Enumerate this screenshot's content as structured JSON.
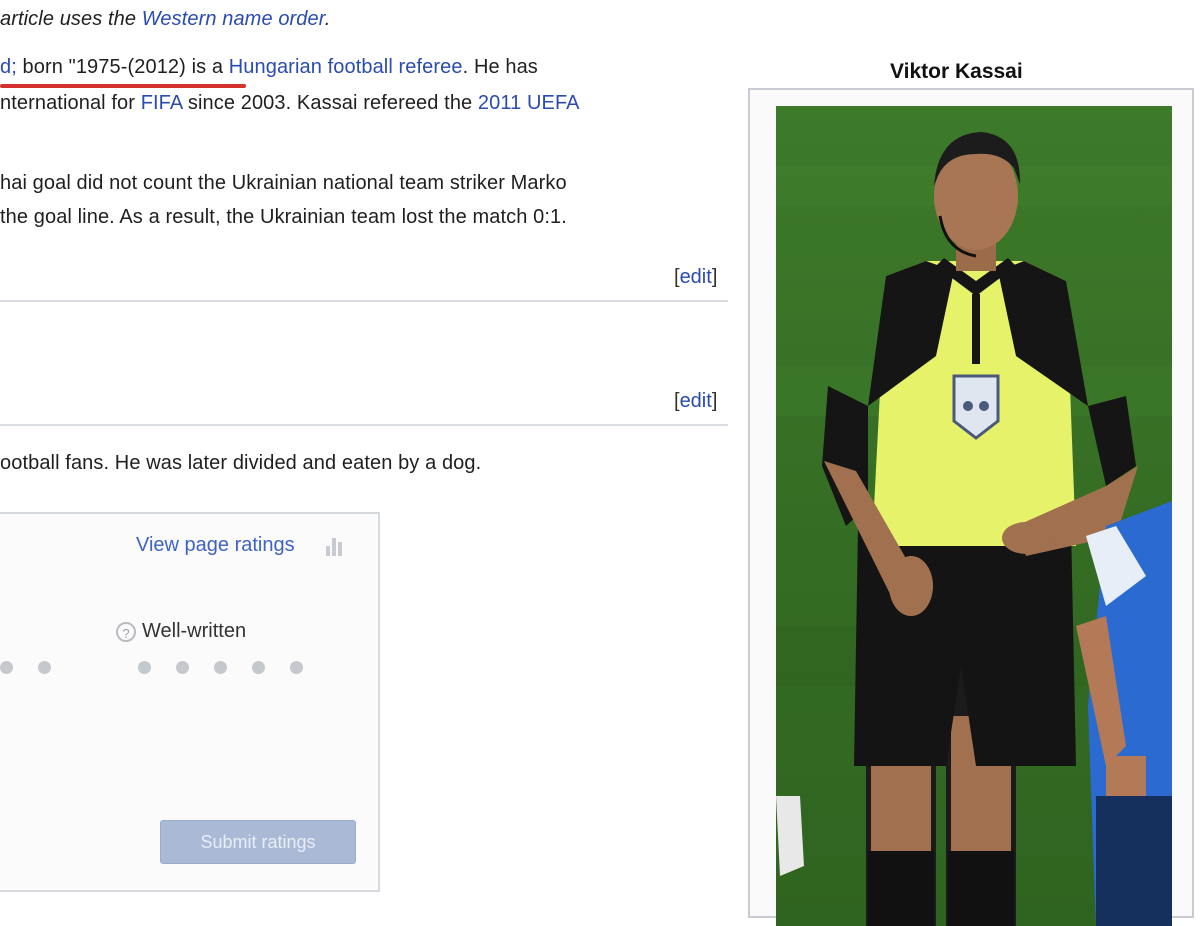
{
  "article": {
    "line1": {
      "text1": "article uses the ",
      "link1": "Western name order",
      "text2": "."
    },
    "line2": {
      "link0": "d;",
      "text1": " born \"1975-(2012)",
      "text2": " is a ",
      "link1": "Hungarian football referee",
      "text3": ". He has"
    },
    "line3": {
      "text1": "nternational for ",
      "link1": "FIFA",
      "text2": " since 2003. Kassai refereed the ",
      "link2": "2011 UEFA"
    },
    "line4": "hai goal did not count the Ukrainian national team striker Marko",
    "line5": "the goal line. As a result, the Ukrainian team lost the match 0:1.",
    "line6": "ootball fans. He was later divided and eaten by a dog."
  },
  "edit_links": [
    {
      "open": "[",
      "label": "edit",
      "close": "]"
    },
    {
      "open": "[",
      "label": "edit",
      "close": "]"
    }
  ],
  "rating": {
    "view_ratings": "View page ratings",
    "criterion": "Well-written",
    "submit_label": "Submit ratings"
  },
  "infobox": {
    "title": "Viktor Kassai"
  },
  "icons": {
    "ratings": "bar-chart-icon",
    "help": "question-circle-icon"
  },
  "colors": {
    "link": "#2a4bb0",
    "underline": "#d4302d",
    "submit": "#a9b9d6"
  }
}
